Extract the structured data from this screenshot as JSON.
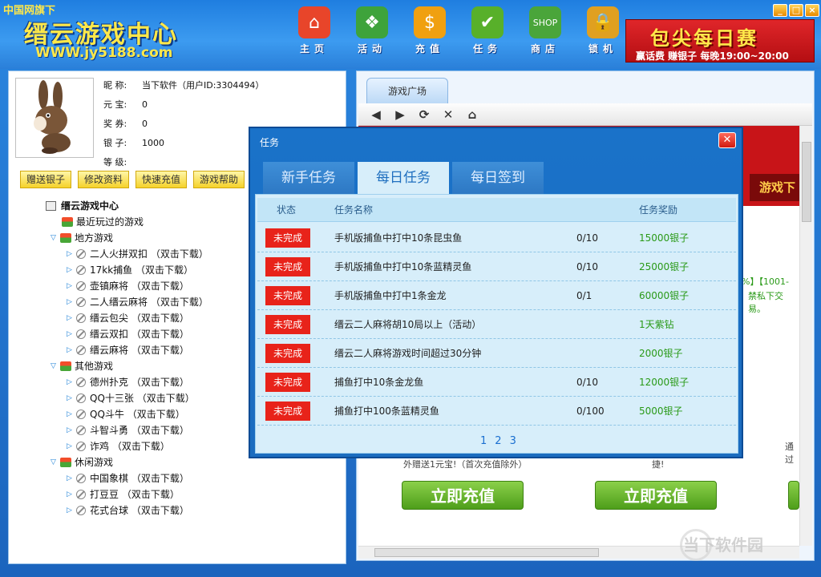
{
  "header": {
    "brand_small": "中国网旗下",
    "brand_title": "缙云游戏中心",
    "brand_url": "WWW.jy5188.com",
    "nav": [
      {
        "label": "主页",
        "icon": "home-icon",
        "glyph": "⌂",
        "color": "#e8452a"
      },
      {
        "label": "活动",
        "icon": "gift-icon",
        "glyph": "❖",
        "color": "#3ea33b"
      },
      {
        "label": "充值",
        "icon": "coin-icon",
        "glyph": "$",
        "color": "#f0a010"
      },
      {
        "label": "任务",
        "icon": "checklist-icon",
        "glyph": "✔",
        "color": "#58b02a"
      },
      {
        "label": "商店",
        "icon": "shop-bag-icon",
        "glyph": "SHOP",
        "color": "#4aa53a"
      },
      {
        "label": "锁机",
        "icon": "lock-icon",
        "glyph": "🔒",
        "color": "#e0a020"
      }
    ],
    "banner_title": "包尖每日赛",
    "banner_sub": "赢话费 赚银子 每晚19:00~20:00"
  },
  "profile": {
    "nickname_label": "昵  称:",
    "nickname_value": "当下软件（用户ID:3304494）",
    "yuanbao_label": "元  宝:",
    "yuanbao_value": "0",
    "coupon_label": "奖  券:",
    "coupon_value": "0",
    "silver_label": "银  子:",
    "silver_value": "1000",
    "level_label": "等  级:",
    "level_value": ""
  },
  "actions": [
    "赠送银子",
    "修改资料",
    "快速充值",
    "游戏帮助"
  ],
  "tree": {
    "root": "缙云游戏中心",
    "recent": "最近玩过的游戏",
    "groups": [
      {
        "name": "地方游戏",
        "items": [
          "二人火拼双扣  （双击下载）",
          "17kk捕鱼  （双击下载）",
          "壶镇麻将  （双击下载）",
          "二人缙云麻将  （双击下载）",
          "缙云包尖  （双击下载）",
          "缙云双扣  （双击下载）",
          "缙云麻将  （双击下载）"
        ]
      },
      {
        "name": "其他游戏",
        "items": [
          "德州扑克  （双击下载）",
          "QQ十三张  （双击下载）",
          "QQ斗牛  （双击下载）",
          "斗智斗勇  （双击下载）",
          "诈鸡  （双击下载）"
        ]
      },
      {
        "name": "休闲游戏",
        "items": [
          "中国象棋  （双击下载）",
          "打豆豆  （双击下载）",
          "花式台球  （双击下载）"
        ]
      }
    ]
  },
  "browser": {
    "tab": "游戏广场",
    "redtab": "游戏下",
    "text1": "%】【1001-",
    "text2": "禁私下交易。",
    "text3": "外赠送1元宝!（首次充值除外）",
    "text4": "捷!",
    "text5": "通过",
    "charge1": "立即充值",
    "charge2": "立即充值"
  },
  "dialog": {
    "title": "任务",
    "tabs": [
      "新手任务",
      "每日任务",
      "每日签到"
    ],
    "active_tab": 1,
    "headers": {
      "status": "状态",
      "name": "任务名称",
      "reward": "任务奖励"
    },
    "tasks": [
      {
        "status": "未完成",
        "name": "手机版捕鱼中打中10条昆虫鱼",
        "progress": "0/10",
        "reward": "15000银子"
      },
      {
        "status": "未完成",
        "name": "手机版捕鱼中打中10条蓝精灵鱼",
        "progress": "0/10",
        "reward": "25000银子"
      },
      {
        "status": "未完成",
        "name": "手机版捕鱼中打中1条金龙",
        "progress": "0/1",
        "reward": "60000银子"
      },
      {
        "status": "未完成",
        "name": "缙云二人麻将胡10局以上（活动）",
        "progress": "",
        "reward": "1天紫钻"
      },
      {
        "status": "未完成",
        "name": "缙云二人麻将游戏时间超过30分钟",
        "progress": "",
        "reward": "2000银子"
      },
      {
        "status": "未完成",
        "name": "捕鱼打中10条金龙鱼",
        "progress": "0/10",
        "reward": "12000银子"
      },
      {
        "status": "未完成",
        "name": "捕鱼打中100条蓝精灵鱼",
        "progress": "0/100",
        "reward": "5000银子"
      }
    ],
    "pages": [
      "1",
      "2",
      "3"
    ]
  },
  "watermark": "当下软件园"
}
